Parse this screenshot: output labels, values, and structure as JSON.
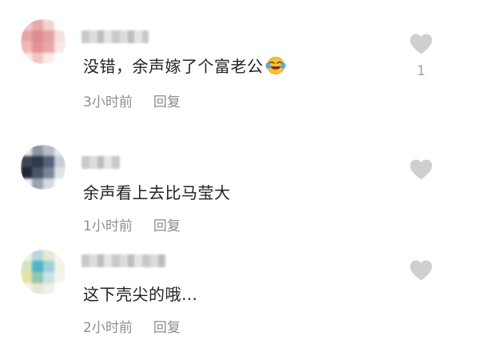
{
  "comments": [
    {
      "text": "没错，余声嫁了个富老公",
      "emoji": "laughing-crying-emoji",
      "time": "3小时前",
      "reply": "回复",
      "likes": "1",
      "avatar_colors": [
        "#f2c9c9",
        "#e9a8a8",
        "#f5d2d2",
        "#ffffff",
        "#eba4a4",
        "#dd8c8c",
        "#e6a0a0",
        "#f6dede",
        "#f0b7b7",
        "#e29494",
        "#eaa6a6",
        "#f9e6e6",
        "#fbe9e9",
        "#f3c6c6",
        "#fbeaea",
        "#ffffff"
      ]
    },
    {
      "text": "余声看上去比马莹大",
      "time": "1小时前",
      "reply": "回复",
      "likes": "",
      "avatar_colors": [
        "#e8eaee",
        "#8d96a6",
        "#b6bcc8",
        "#e6e8ec",
        "#3d4656",
        "#2e3a4d",
        "#56607a",
        "#c8ccd6",
        "#1f2937",
        "#4a5568",
        "#7a8498",
        "#dfe2e8",
        "#f1f2f5",
        "#9aa2b2",
        "#d6d9e0",
        "#ffffff"
      ]
    },
    {
      "text": "这下壳尖的哦…",
      "time": "2小时前",
      "reply": "回复",
      "likes": "",
      "avatar_colors": [
        "#f3f3e8",
        "#b8d7e0",
        "#e4e8d4",
        "#f7f7f0",
        "#d7e4c2",
        "#4fb3c8",
        "#9fd0da",
        "#f2f2e6",
        "#e9e1a6",
        "#8fc7b0",
        "#c6e3e6",
        "#f5f5ec",
        "#f4f4ec",
        "#e7e7d7",
        "#f0f0e4",
        "#ffffff"
      ]
    }
  ],
  "colors": {
    "text": "#222222",
    "meta": "#8e8e8e",
    "heart": "#cfcfcf"
  }
}
